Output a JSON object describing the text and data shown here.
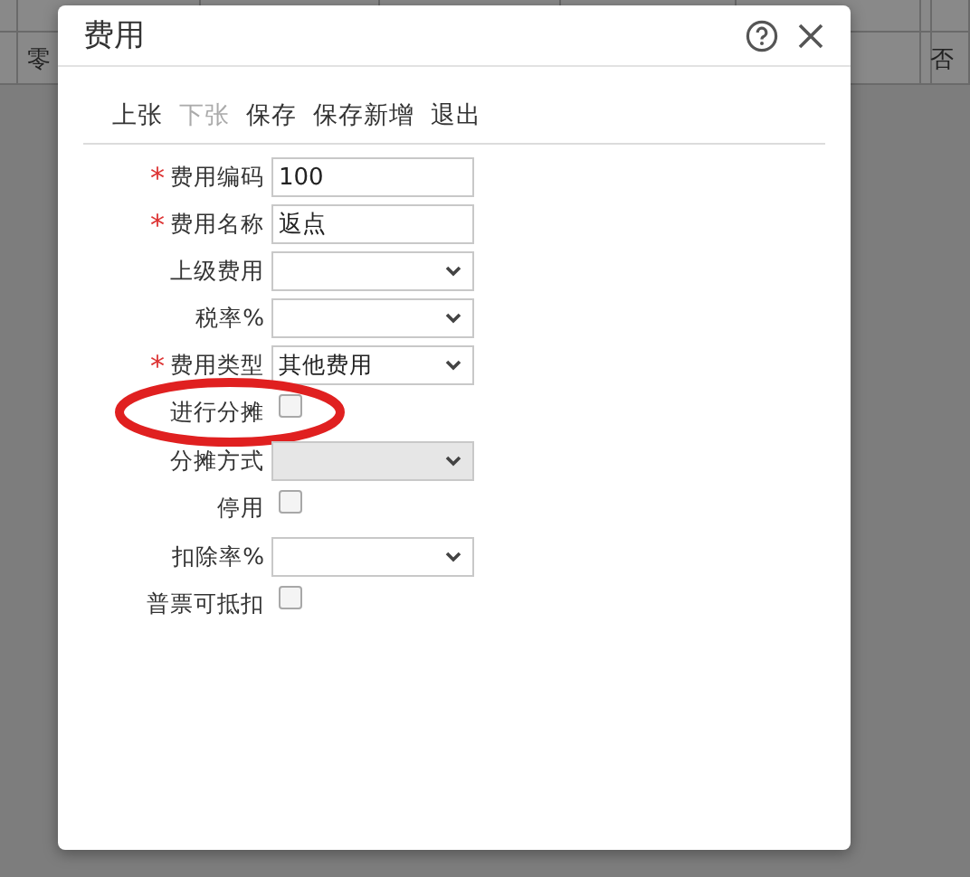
{
  "background_table": {
    "rows": [
      {
        "cells": [
          "",
          "",
          "",
          "",
          "",
          "",
          "",
          ""
        ]
      },
      {
        "cells": [
          "",
          "零",
          "",
          "",
          "",
          "",
          "",
          "否"
        ]
      }
    ]
  },
  "dialog": {
    "title": "费用",
    "toolbar": [
      {
        "label": "上张",
        "disabled": false
      },
      {
        "label": "下张",
        "disabled": true
      },
      {
        "label": "保存",
        "disabled": false
      },
      {
        "label": "保存新增",
        "disabled": false
      },
      {
        "label": "退出",
        "disabled": false
      }
    ],
    "fields": [
      {
        "kind": "text",
        "label": "费用编码",
        "required_mark": "*",
        "value": "100"
      },
      {
        "kind": "text",
        "label": "费用名称",
        "required_mark": "*",
        "value": "返点"
      },
      {
        "kind": "select",
        "label": "上级费用",
        "disabled": false
      },
      {
        "kind": "select",
        "label": "税率%",
        "disabled": false
      },
      {
        "kind": "select",
        "label": "费用类型",
        "required_mark": "*",
        "disabled": false,
        "value": "其他费用"
      },
      {
        "kind": "checkbox",
        "label": "进行分摊",
        "checked": false,
        "highlighted": true
      },
      {
        "kind": "select",
        "label": "分摊方式",
        "disabled": true
      },
      {
        "kind": "checkbox",
        "label": "停用",
        "checked": false,
        "highlighted": false
      },
      {
        "kind": "select",
        "label": "扣除率%",
        "disabled": false
      },
      {
        "kind": "checkbox",
        "label": "普票可抵扣",
        "checked": false,
        "highlighted": false
      }
    ]
  }
}
